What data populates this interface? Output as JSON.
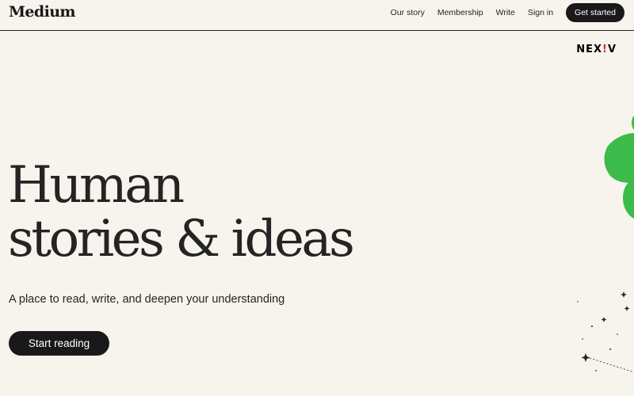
{
  "header": {
    "logo": "Medium",
    "nav": {
      "our_story": "Our story",
      "membership": "Membership",
      "write": "Write",
      "sign_in": "Sign in",
      "get_started": "Get started"
    }
  },
  "watermark": {
    "left": "NEX",
    "mark": "!",
    "right": "V"
  },
  "hero": {
    "title_line1": "Human",
    "title_line2": "stories & ideas",
    "subtitle": "A place to read, write, and deepen your understanding",
    "cta": "Start reading"
  },
  "colors": {
    "background": "#f7f4ed",
    "text": "#242424",
    "button": "#191919",
    "accent_green": "#3dbb4a",
    "watermark_red": "#e0281f"
  },
  "icons": {
    "green_shapes": "green-blob-icon",
    "stars": "star-sparkle-icon"
  }
}
